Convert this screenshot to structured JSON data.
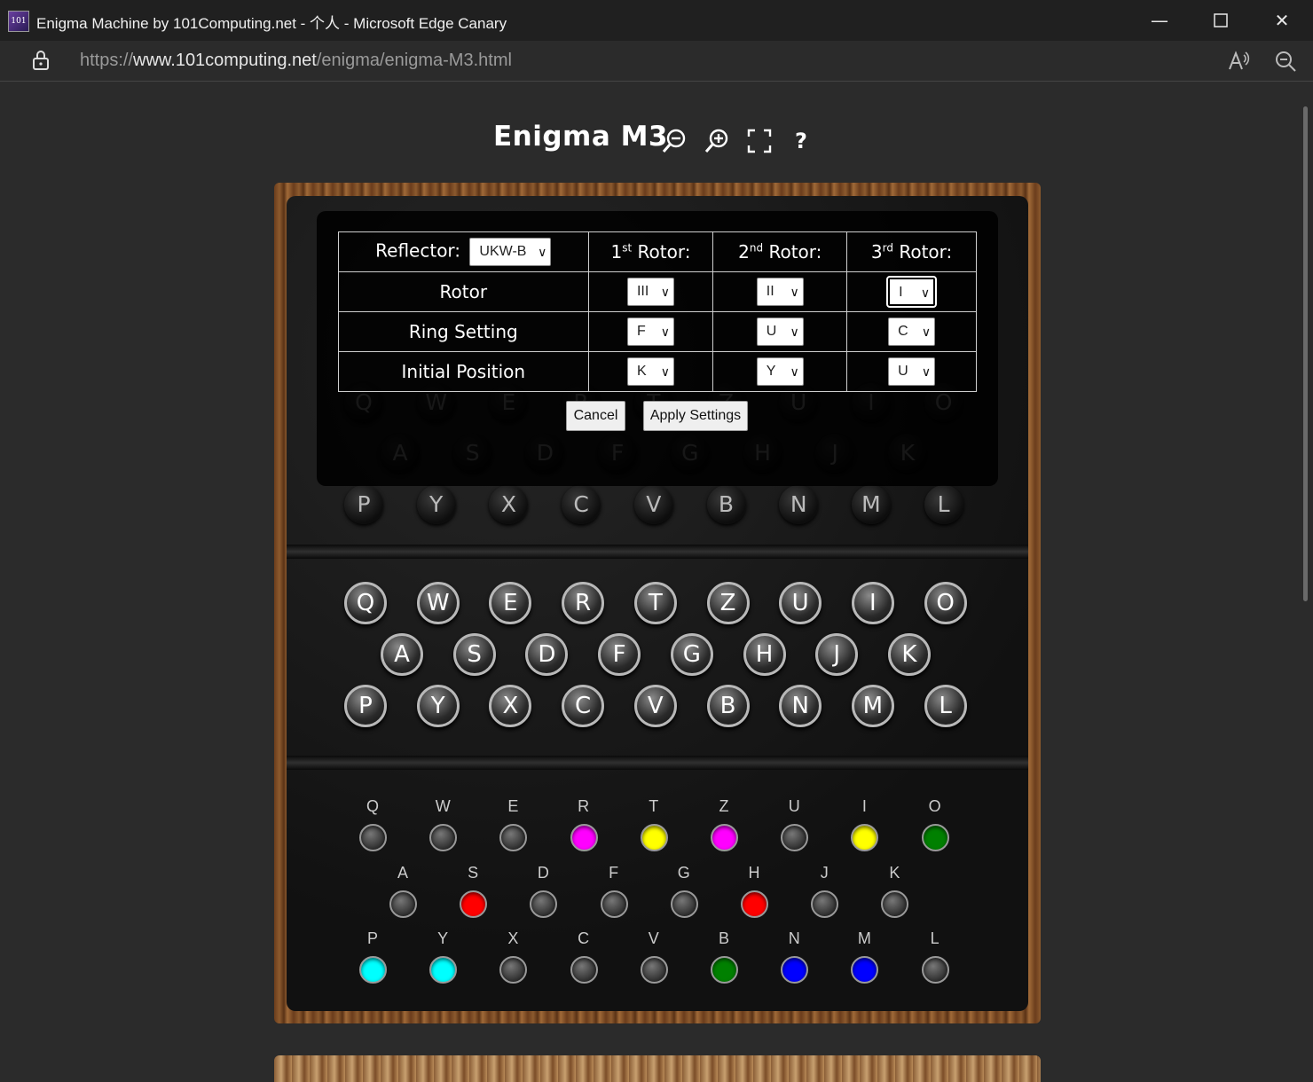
{
  "window": {
    "title": "Enigma Machine by 101Computing.net - 个人 - Microsoft Edge Canary",
    "favicon_text": "101"
  },
  "address": {
    "url_scheme": "https://",
    "url_host": "www.101computing.net",
    "url_path": "/enigma/enigma-M3.html"
  },
  "page": {
    "title": "Enigma M3",
    "help_label": "?"
  },
  "lampboard": {
    "rows": [
      [
        "Q",
        "W",
        "E",
        "R",
        "T",
        "Z",
        "U",
        "I",
        "O"
      ],
      [
        "A",
        "S",
        "D",
        "F",
        "G",
        "H",
        "J",
        "K"
      ],
      [
        "P",
        "Y",
        "X",
        "C",
        "V",
        "B",
        "N",
        "M",
        "L"
      ]
    ]
  },
  "keyboard": {
    "rows": [
      [
        "Q",
        "W",
        "E",
        "R",
        "T",
        "Z",
        "U",
        "I",
        "O"
      ],
      [
        "A",
        "S",
        "D",
        "F",
        "G",
        "H",
        "J",
        "K"
      ],
      [
        "P",
        "Y",
        "X",
        "C",
        "V",
        "B",
        "N",
        "M",
        "L"
      ]
    ]
  },
  "plugboard": {
    "rows": [
      [
        {
          "l": "Q",
          "c": ""
        },
        {
          "l": "W",
          "c": ""
        },
        {
          "l": "E",
          "c": ""
        },
        {
          "l": "R",
          "c": "#ff00ff"
        },
        {
          "l": "T",
          "c": "#ffff00"
        },
        {
          "l": "Z",
          "c": "#ff00ff"
        },
        {
          "l": "U",
          "c": ""
        },
        {
          "l": "I",
          "c": "#ffff00"
        },
        {
          "l": "O",
          "c": "#008000"
        }
      ],
      [
        {
          "l": "A",
          "c": ""
        },
        {
          "l": "S",
          "c": "#ff0000"
        },
        {
          "l": "D",
          "c": ""
        },
        {
          "l": "F",
          "c": ""
        },
        {
          "l": "G",
          "c": ""
        },
        {
          "l": "H",
          "c": "#ff0000"
        },
        {
          "l": "J",
          "c": ""
        },
        {
          "l": "K",
          "c": ""
        }
      ],
      [
        {
          "l": "P",
          "c": "#00ffff"
        },
        {
          "l": "Y",
          "c": "#00ffff"
        },
        {
          "l": "X",
          "c": ""
        },
        {
          "l": "C",
          "c": ""
        },
        {
          "l": "V",
          "c": ""
        },
        {
          "l": "B",
          "c": "#008000"
        },
        {
          "l": "N",
          "c": "#0000ff"
        },
        {
          "l": "M",
          "c": "#0000ff"
        },
        {
          "l": "L",
          "c": ""
        }
      ]
    ]
  },
  "settings": {
    "reflector_label": "Reflector:",
    "reflector_value": "UKW-B",
    "rotor_headers": [
      {
        "num": "1",
        "suffix": "st",
        "word": " Rotor:"
      },
      {
        "num": "2",
        "suffix": "nd",
        "word": " Rotor:"
      },
      {
        "num": "3",
        "suffix": "rd",
        "word": " Rotor:"
      }
    ],
    "rows": [
      {
        "label": "Rotor",
        "values": [
          "III",
          "II",
          "I"
        ]
      },
      {
        "label": "Ring Setting",
        "values": [
          "F",
          "U",
          "C"
        ]
      },
      {
        "label": "Initial Position",
        "values": [
          "K",
          "Y",
          "U"
        ]
      }
    ],
    "cancel_label": "Cancel",
    "apply_label": "Apply Settings"
  }
}
